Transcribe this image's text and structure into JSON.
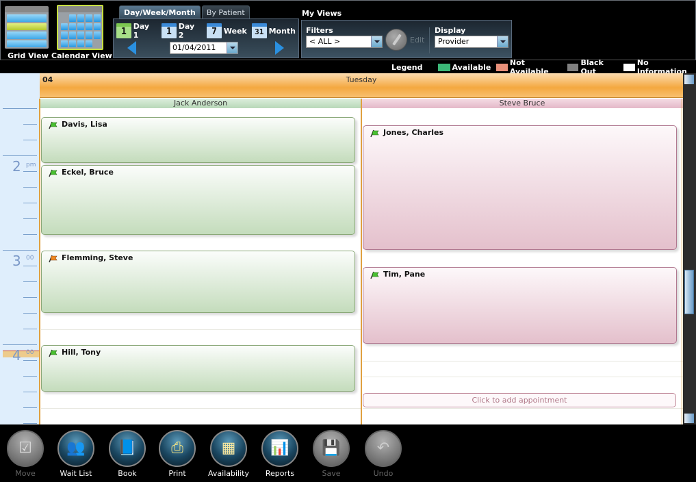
{
  "view_switch": {
    "grid_view_label": "Grid View",
    "calendar_view_label": "Calendar View",
    "active": "Calendar View"
  },
  "mode_tabs": [
    {
      "label": "Day/Week/Month",
      "active": true
    },
    {
      "label": "By Patient",
      "active": false
    }
  ],
  "range_buttons": [
    {
      "icon_number": "1",
      "label": "Day 1",
      "icon_color": "green"
    },
    {
      "icon_number": "1",
      "label": "Day 2",
      "icon_color": "blue"
    },
    {
      "icon_number": "7",
      "label": "Week",
      "icon_color": "blue"
    },
    {
      "icon_number": "31",
      "label": "Month",
      "icon_color": "blue"
    }
  ],
  "date_picker": {
    "value": "01/04/2011"
  },
  "my_views": {
    "title": "My Views",
    "filters_label": "Filters",
    "filters_value": "< ALL >",
    "edit_label": "Edit",
    "display_label": "Display",
    "display_value": "Provider"
  },
  "legend": {
    "title": "Legend",
    "items": [
      {
        "label": "Available",
        "color": "#3cb878"
      },
      {
        "label": "Not Available",
        "color": "#e8907a"
      },
      {
        "label": "Black Out",
        "color": "#808080"
      },
      {
        "label": "No Information",
        "color": "#ffffff"
      }
    ]
  },
  "day_header": {
    "day_number": "04",
    "day_name": "Tuesday"
  },
  "time_labels": [
    {
      "hour": "2",
      "suffix": "pm"
    },
    {
      "hour": "3",
      "suffix": "00"
    },
    {
      "hour": "4",
      "suffix": "00"
    }
  ],
  "providers": [
    {
      "name": "Jack Anderson",
      "status": "available",
      "appointments": [
        {
          "patient": "Davis, Lisa",
          "flag_color": "green"
        },
        {
          "patient": "Eckel, Bruce",
          "flag_color": "green"
        },
        {
          "patient": "Flemming, Steve",
          "flag_color": "orange"
        },
        {
          "patient": "Hill, Tony",
          "flag_color": "green"
        }
      ]
    },
    {
      "name": "Steve Bruce",
      "status": "not-available",
      "appointments": [
        {
          "patient": "Jones, Charles",
          "flag_color": "green"
        },
        {
          "patient": "Tim, Pane",
          "flag_color": "green"
        }
      ],
      "add_prompt": "Click to add appointment"
    }
  ],
  "bottom_toolbar": [
    {
      "label": "Move",
      "icon": "move-icon",
      "enabled": false
    },
    {
      "label": "Wait List",
      "icon": "wait-list-icon",
      "enabled": true
    },
    {
      "label": "Book",
      "icon": "book-icon",
      "enabled": true
    },
    {
      "label": "Print",
      "icon": "printer-icon",
      "enabled": true
    },
    {
      "label": "Availability",
      "icon": "availability-icon",
      "enabled": true
    },
    {
      "label": "Reports",
      "icon": "reports-icon",
      "enabled": true
    },
    {
      "label": "Save",
      "icon": "save-icon",
      "enabled": false
    },
    {
      "label": "Undo",
      "icon": "undo-icon",
      "enabled": false
    }
  ]
}
